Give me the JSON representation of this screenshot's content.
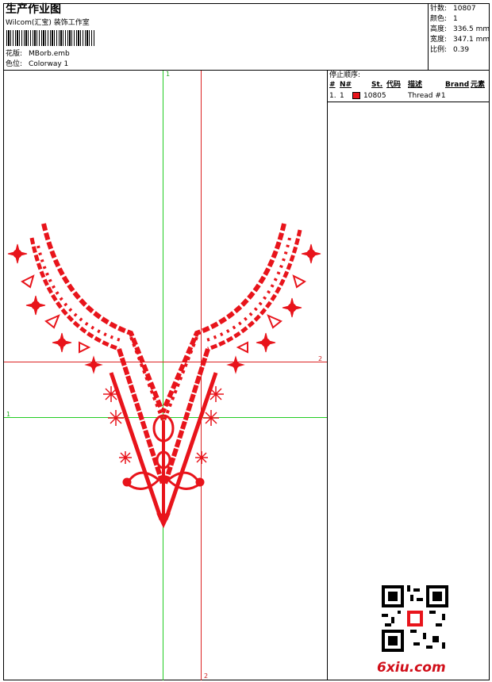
{
  "header": {
    "title": "生产作业图",
    "company": "Wilcom(汇宝) 装饰工作室",
    "design_label": "花版:",
    "design_value": "MBorb.emb",
    "color_label": "色位:",
    "color_value": "Colorway 1"
  },
  "stats": {
    "stitches_label": "针数:",
    "stitches_value": "10807",
    "colors_label": "颜色:",
    "colors_value": "1",
    "height_label": "高度:",
    "height_value": "336.5 mm",
    "width_label": "宽度:",
    "width_value": "347.1 mm",
    "scale_label": "比例:",
    "scale_value": "0.39"
  },
  "stop_sequence": {
    "title": "停止顺序:",
    "columns": [
      "#",
      "N#",
      "St.",
      "代码",
      "描述",
      "Brand",
      "元素"
    ],
    "rows": [
      {
        "index": "1.",
        "needle": "1",
        "code": "10805",
        "description": "Thread #1",
        "color": "#e8141b"
      }
    ]
  },
  "guides": {
    "green_label_top": "1",
    "green_label_left": "1",
    "red_label_right": "2",
    "red_label_bottom": "2"
  },
  "watermark": {
    "text": "6xiu.com"
  },
  "colors": {
    "thread": "#e8141b",
    "guide_green": "#22cc22",
    "guide_red": "#dd2222"
  }
}
